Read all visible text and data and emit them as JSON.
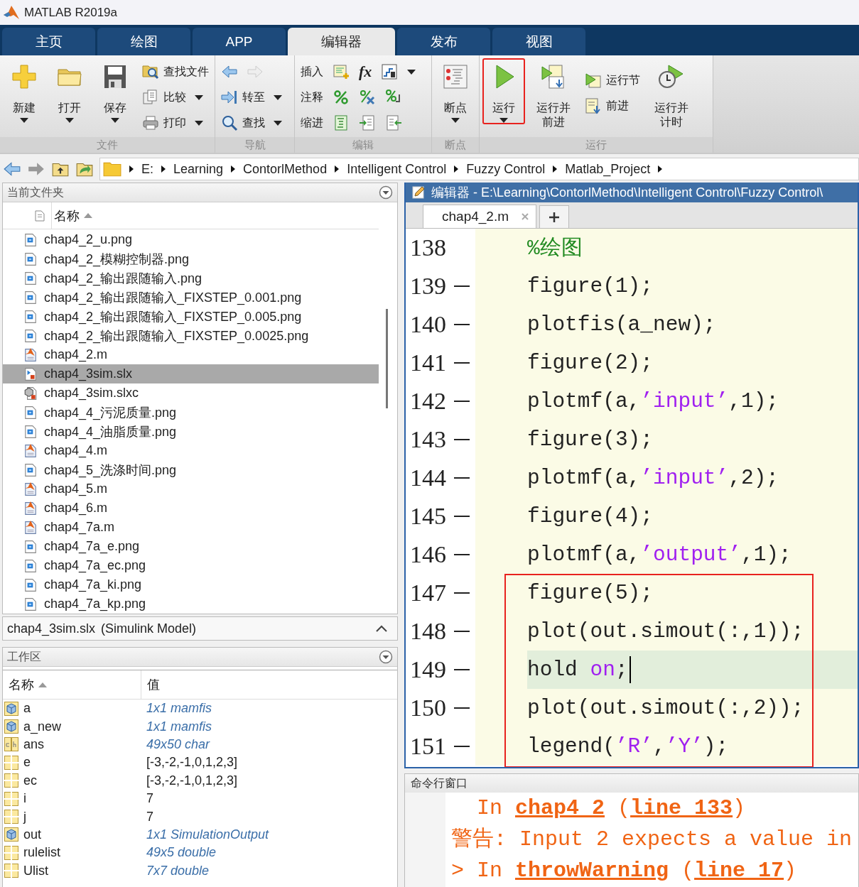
{
  "window": {
    "title": "MATLAB R2019a"
  },
  "tabs": [
    {
      "label": "主页",
      "selected": false
    },
    {
      "label": "绘图",
      "selected": false
    },
    {
      "label": "APP",
      "selected": false
    },
    {
      "label": "编辑器",
      "selected": true
    },
    {
      "label": "发布",
      "selected": false
    },
    {
      "label": "视图",
      "selected": false
    }
  ],
  "ribbon": {
    "file": {
      "label": "文件",
      "new": "新建",
      "open": "打开",
      "save": "保存",
      "find_files": "查找文件",
      "compare": "比较",
      "print": "打印"
    },
    "navigate": {
      "label": "导航",
      "go_to": "转至",
      "find": "查找"
    },
    "edit": {
      "label": "编辑",
      "insert": "插入",
      "function_symbol": "fx",
      "comment": "注释",
      "indent": "缩进"
    },
    "breakpoints": {
      "label": "断点",
      "button": "断点"
    },
    "run": {
      "label": "运行",
      "run": "运行",
      "run_marked": true,
      "run_and_advance": "运行并前进",
      "run_section": "运行节",
      "advance": "前进",
      "run_and_time": "运行并计时"
    }
  },
  "address_bar": {
    "segments": [
      "E:",
      "Learning",
      "ContorlMethod",
      "Intelligent Control",
      "Fuzzy Control",
      "Matlab_Project"
    ]
  },
  "current_folder": {
    "title": "当前文件夹",
    "column": "名称",
    "files": [
      {
        "name": "chap4_2_u.png",
        "kind": "image",
        "selected": false
      },
      {
        "name": "chap4_2_模糊控制器.png",
        "kind": "image",
        "selected": false
      },
      {
        "name": "chap4_2_输出跟随输入.png",
        "kind": "image",
        "selected": false
      },
      {
        "name": "chap4_2_输出跟随输入_FIXSTEP_0.001.png",
        "kind": "image",
        "selected": false
      },
      {
        "name": "chap4_2_输出跟随输入_FIXSTEP_0.005.png",
        "kind": "image",
        "selected": false
      },
      {
        "name": "chap4_2_输出跟随输入_FIXSTEP_0.0025.png",
        "kind": "image",
        "selected": false
      },
      {
        "name": "chap4_2.m",
        "kind": "script",
        "selected": false
      },
      {
        "name": "chap4_3sim.slx",
        "kind": "model",
        "selected": true
      },
      {
        "name": "chap4_3sim.slxc",
        "kind": "cache",
        "selected": false
      },
      {
        "name": "chap4_4_污泥质量.png",
        "kind": "image",
        "selected": false
      },
      {
        "name": "chap4_4_油脂质量.png",
        "kind": "image",
        "selected": false
      },
      {
        "name": "chap4_4.m",
        "kind": "script",
        "selected": false
      },
      {
        "name": "chap4_5_洗涤时间.png",
        "kind": "image",
        "selected": false
      },
      {
        "name": "chap4_5.m",
        "kind": "script",
        "selected": false
      },
      {
        "name": "chap4_6.m",
        "kind": "script",
        "selected": false
      },
      {
        "name": "chap4_7a.m",
        "kind": "script",
        "selected": false
      },
      {
        "name": "chap4_7a_e.png",
        "kind": "image",
        "selected": false
      },
      {
        "name": "chap4_7a_ec.png",
        "kind": "image",
        "selected": false
      },
      {
        "name": "chap4_7a_ki.png",
        "kind": "image",
        "selected": false
      },
      {
        "name": "chap4_7a_kp.png",
        "kind": "image",
        "selected": false
      }
    ],
    "details": {
      "name": "chap4_3sim.slx",
      "type": "(Simulink Model)"
    }
  },
  "workspace": {
    "title": "工作区",
    "columns": [
      "名称",
      "值"
    ],
    "variables": [
      {
        "name": "a",
        "kind": "object",
        "value": "1x1 mamfis",
        "summary": true
      },
      {
        "name": "a_new",
        "kind": "object",
        "value": "1x1 mamfis",
        "summary": true
      },
      {
        "name": "ans",
        "kind": "char",
        "value": "49x50 char",
        "summary": true
      },
      {
        "name": "e",
        "kind": "matrix",
        "value": "[-3,-2,-1,0,1,2,3]",
        "summary": false
      },
      {
        "name": "ec",
        "kind": "matrix",
        "value": "[-3,-2,-1,0,1,2,3]",
        "summary": false
      },
      {
        "name": "i",
        "kind": "matrix",
        "value": "7",
        "summary": false
      },
      {
        "name": "j",
        "kind": "matrix",
        "value": "7",
        "summary": false
      },
      {
        "name": "out",
        "kind": "object",
        "value": "1x1 SimulationOutput",
        "summary": true
      },
      {
        "name": "rulelist",
        "kind": "matrix",
        "value": "49x5 double",
        "summary": true
      },
      {
        "name": "Ulist",
        "kind": "matrix",
        "value": "7x7 double",
        "summary": true
      }
    ]
  },
  "editor": {
    "title": "编辑器 - E:\\Learning\\ContorlMethod\\Intelligent Control\\Fuzzy Control\\",
    "tab": "chap4_2.m",
    "lines": [
      {
        "number": "138",
        "executable": false,
        "current": false,
        "marked": false,
        "segments": [
          {
            "kind": "comment",
            "text": "%绘图"
          }
        ]
      },
      {
        "number": "139",
        "executable": true,
        "current": false,
        "marked": false,
        "segments": [
          {
            "kind": "code",
            "text": "figure(1);"
          }
        ]
      },
      {
        "number": "140",
        "executable": true,
        "current": false,
        "marked": false,
        "segments": [
          {
            "kind": "code",
            "text": "plotfis(a_new);"
          }
        ]
      },
      {
        "number": "141",
        "executable": true,
        "current": false,
        "marked": false,
        "segments": [
          {
            "kind": "code",
            "text": "figure(2);"
          }
        ]
      },
      {
        "number": "142",
        "executable": true,
        "current": false,
        "marked": false,
        "segments": [
          {
            "kind": "code",
            "text": "plotmf(a,"
          },
          {
            "kind": "string",
            "text": "’input’"
          },
          {
            "kind": "code",
            "text": ",1);"
          }
        ]
      },
      {
        "number": "143",
        "executable": true,
        "current": false,
        "marked": false,
        "segments": [
          {
            "kind": "code",
            "text": "figure(3);"
          }
        ]
      },
      {
        "number": "144",
        "executable": true,
        "current": false,
        "marked": false,
        "segments": [
          {
            "kind": "code",
            "text": "plotmf(a,"
          },
          {
            "kind": "string",
            "text": "’input’"
          },
          {
            "kind": "code",
            "text": ",2);"
          }
        ]
      },
      {
        "number": "145",
        "executable": true,
        "current": false,
        "marked": false,
        "segments": [
          {
            "kind": "code",
            "text": "figure(4);"
          }
        ]
      },
      {
        "number": "146",
        "executable": true,
        "current": false,
        "marked": false,
        "segments": [
          {
            "kind": "code",
            "text": "plotmf(a,"
          },
          {
            "kind": "string",
            "text": "’output’"
          },
          {
            "kind": "code",
            "text": ",1);"
          }
        ]
      },
      {
        "number": "147",
        "executable": true,
        "current": false,
        "marked": true,
        "segments": [
          {
            "kind": "code",
            "text": "figure(5);"
          }
        ]
      },
      {
        "number": "148",
        "executable": true,
        "current": false,
        "marked": true,
        "segments": [
          {
            "kind": "code",
            "text": "plot(out.simout(:,1));"
          }
        ]
      },
      {
        "number": "149",
        "executable": true,
        "current": true,
        "marked": true,
        "segments": [
          {
            "kind": "code",
            "text": "hold "
          },
          {
            "kind": "keyword",
            "text": "on"
          },
          {
            "kind": "code",
            "text": ";"
          }
        ]
      },
      {
        "number": "150",
        "executable": true,
        "current": false,
        "marked": true,
        "segments": [
          {
            "kind": "code",
            "text": "plot(out.simout(:,2));"
          }
        ]
      },
      {
        "number": "151",
        "executable": true,
        "current": false,
        "marked": true,
        "segments": [
          {
            "kind": "code",
            "text": "legend("
          },
          {
            "kind": "string",
            "text": "’R’"
          },
          {
            "kind": "code",
            "text": ","
          },
          {
            "kind": "string",
            "text": "’Y’"
          },
          {
            "kind": "code",
            "text": ");"
          }
        ]
      }
    ]
  },
  "command_window": {
    "title": "命令行窗口",
    "lines": [
      {
        "indent": true,
        "segments": [
          {
            "kind": "text",
            "text": "In "
          },
          {
            "kind": "link",
            "text": "chap4 2"
          },
          {
            "kind": "text",
            "text": " ("
          },
          {
            "kind": "link",
            "text": "line 133"
          },
          {
            "kind": "text",
            "text": ")"
          }
        ]
      },
      {
        "indent": false,
        "segments": [
          {
            "kind": "text",
            "text": "警告: Input 2 expects a value in"
          }
        ]
      },
      {
        "indent": false,
        "segments": [
          {
            "kind": "text",
            "text": "> In "
          },
          {
            "kind": "link",
            "text": "throwWarning"
          },
          {
            "kind": "text",
            "text": " ("
          },
          {
            "kind": "link",
            "text": "line 17"
          },
          {
            "kind": "text",
            "text": ")"
          }
        ]
      }
    ]
  }
}
